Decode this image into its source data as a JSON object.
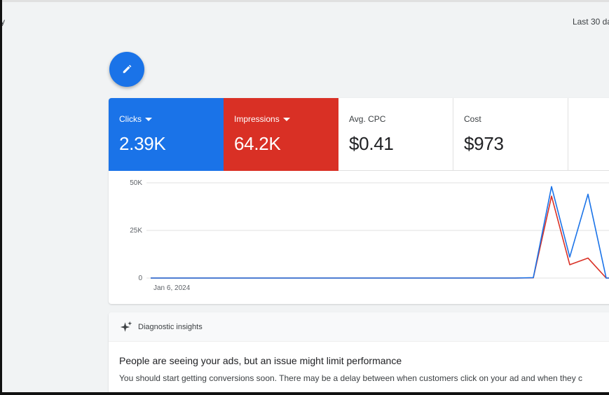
{
  "header": {
    "left_fragment": "y",
    "date_range": "Last 30 da"
  },
  "metrics": [
    {
      "label": "Clicks",
      "value": "2.39K",
      "selected": true,
      "color": "#1a73e8"
    },
    {
      "label": "Impressions",
      "value": "64.2K",
      "selected": true,
      "color": "#d93025"
    },
    {
      "label": "Avg. CPC",
      "value": "$0.41",
      "selected": false
    },
    {
      "label": "Cost",
      "value": "$973",
      "selected": false
    }
  ],
  "chart_data": {
    "type": "line",
    "y_ticks": [
      "50K",
      "25K",
      "0"
    ],
    "ylim": [
      0,
      50000
    ],
    "x_start_label": "Jan 6, 2024",
    "x": [
      0,
      1,
      2,
      3,
      4,
      5,
      6,
      7,
      8,
      9,
      10,
      11,
      12,
      13,
      14,
      15,
      16,
      17,
      18,
      19,
      20,
      21,
      22,
      23,
      24,
      25,
      26,
      27
    ],
    "series": [
      {
        "color": "#1a73e8",
        "values": [
          0,
          0,
          0,
          0,
          0,
          0,
          0,
          0,
          0,
          0,
          0,
          0,
          0,
          0,
          0,
          0,
          0,
          0,
          0,
          0,
          0,
          200,
          48000,
          11000,
          44000,
          0,
          0,
          0
        ]
      },
      {
        "color": "#d93025",
        "values": [
          0,
          0,
          0,
          0,
          0,
          0,
          0,
          0,
          0,
          0,
          0,
          0,
          0,
          0,
          0,
          0,
          0,
          0,
          0,
          0,
          0,
          100,
          43000,
          7000,
          10500,
          0,
          0,
          0
        ]
      }
    ],
    "grid": true
  },
  "insights": {
    "header_label": "Diagnostic insights",
    "title": "People are seeing your ads, but an issue might limit performance",
    "body": "You should start getting conversions soon. There may be a delay between when customers click on your ad and when they c"
  }
}
